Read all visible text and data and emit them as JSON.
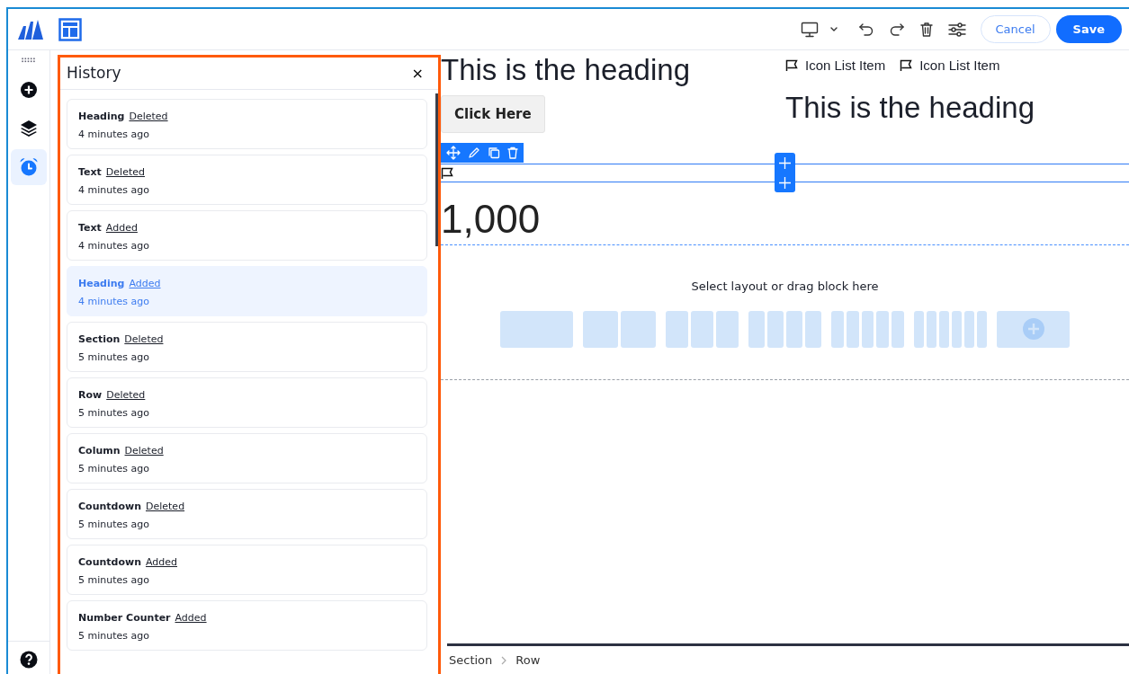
{
  "toolbar": {
    "cancel": "Cancel",
    "save": "Save"
  },
  "rail": {
    "items": [
      {
        "kind": "add",
        "selected": false
      },
      {
        "kind": "layers",
        "selected": false
      },
      {
        "kind": "history",
        "selected": true
      }
    ]
  },
  "history": {
    "title": "History",
    "close": "×",
    "entries": [
      {
        "element": "Heading",
        "action": "Deleted",
        "time": "4 minutes ago",
        "selected": false
      },
      {
        "element": "Text",
        "action": "Deleted",
        "time": "4 minutes ago",
        "selected": false
      },
      {
        "element": "Text",
        "action": "Added",
        "time": "4 minutes ago",
        "selected": false
      },
      {
        "element": "Heading",
        "action": "Added",
        "time": "4 minutes ago",
        "selected": true
      },
      {
        "element": "Section",
        "action": "Deleted",
        "time": "5 minutes ago",
        "selected": false
      },
      {
        "element": "Row",
        "action": "Deleted",
        "time": "5 minutes ago",
        "selected": false
      },
      {
        "element": "Column",
        "action": "Deleted",
        "time": "5 minutes ago",
        "selected": false
      },
      {
        "element": "Countdown",
        "action": "Deleted",
        "time": "5 minutes ago",
        "selected": false
      },
      {
        "element": "Countdown",
        "action": "Added",
        "time": "5 minutes ago",
        "selected": false
      },
      {
        "element": "Number Counter",
        "action": "Added",
        "time": "5 minutes ago",
        "selected": false
      }
    ]
  },
  "canvas": {
    "heading_left": "This is the heading",
    "button": "Click Here",
    "icon_list": [
      "Icon List Item",
      "Icon List Item"
    ],
    "heading_right": "This is the heading",
    "counter": "1,000",
    "empty_prompt": "Select layout or drag block here"
  },
  "breadcrumb": [
    "Section",
    "Row"
  ]
}
